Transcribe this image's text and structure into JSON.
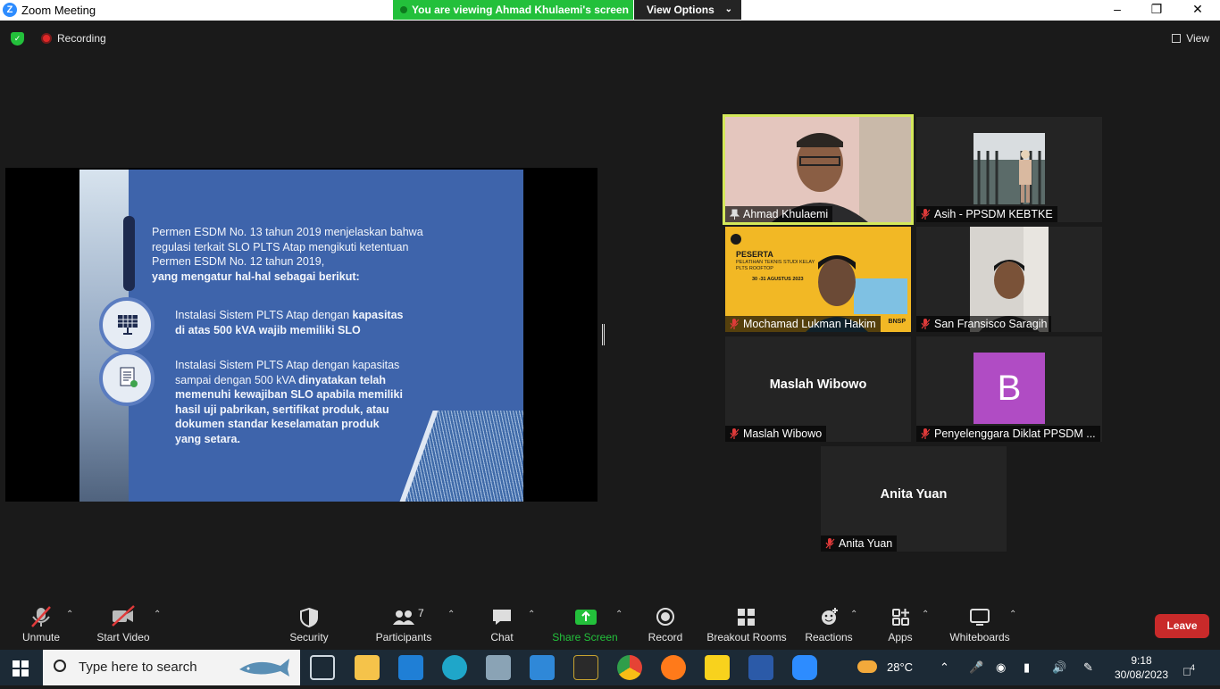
{
  "window": {
    "title": "Zoom Meeting",
    "viewing_banner": "You are viewing Ahmad Khulaemi's screen",
    "view_options": "View Options",
    "controls": {
      "minimize": "–",
      "restore": "❐",
      "close": "✕"
    }
  },
  "topbar": {
    "recording_label": "Recording",
    "view_label": "View"
  },
  "slide": {
    "intro_line1": "Permen ESDM No. 13 tahun 2019 menjelaskan bahwa",
    "intro_line2": "regulasi terkait SLO PLTS Atap mengikuti ketentuan",
    "intro_line3": "Permen ESDM No. 12 tahun 2019,",
    "intro_bold": "yang mengatur hal-hal sebagai berikut:",
    "point1_a": "Instalasi Sistem PLTS Atap dengan ",
    "point1_b": "kapasitas",
    "point1_c": "di atas 500 kVA wajib memiliki SLO",
    "point2_a": "Instalasi Sistem PLTS Atap dengan kapasitas",
    "point2_b": "sampai dengan 500 kVA ",
    "point2_c": "dinyatakan telah",
    "point2_d": "memenuhi kewajiban SLO apabila memiliki",
    "point2_e": "hasil uji pabrikan, sertifikat produk, atau",
    "point2_f": "dokumen standar keselamatan produk",
    "point2_g": "yang setara."
  },
  "participants": [
    {
      "name": "Ahmad Khulaemi",
      "video": true,
      "active": true
    },
    {
      "name": "Asih - PPSDM KEBTKE",
      "video": true,
      "muted": true
    },
    {
      "name": "Mochamad Lukman Hakim",
      "video": true,
      "muted": true,
      "background_heading": "PESERTA",
      "background_line1": "PELATIHAN TEKNIS STUDI KELAY",
      "background_line2": "PLTS ROOFTOP",
      "background_line3": "30 -31 AGUSTUS 2023",
      "background_badge": "BNSP"
    },
    {
      "name": "San Fransisco Saragih",
      "video": true,
      "muted": true
    },
    {
      "name": "Maslah Wibowo",
      "video": false,
      "muted": true,
      "display": "Maslah Wibowo"
    },
    {
      "name": "Penyelenggara Diklat PPSDM ...",
      "video": false,
      "muted": true,
      "avatar_letter": "B"
    },
    {
      "name": "Anita Yuan",
      "video": false,
      "muted": true,
      "display": "Anita Yuan"
    }
  ],
  "toolbar": {
    "unmute": "Unmute",
    "start_video": "Start Video",
    "security": "Security",
    "participants": "Participants",
    "participants_count": "7",
    "chat": "Chat",
    "share_screen": "Share Screen",
    "record": "Record",
    "breakout_rooms": "Breakout Rooms",
    "reactions": "Reactions",
    "apps": "Apps",
    "whiteboards": "Whiteboards",
    "leave": "Leave"
  },
  "taskbar": {
    "search_placeholder": "Type here to search",
    "temperature": "28°C",
    "time": "9:18",
    "date": "30/08/2023",
    "notification_count": "4"
  },
  "colors": {
    "accent_green": "#23c03b",
    "leave_red": "#c92a2a",
    "active_speaker": "#d4e85a",
    "zoom_blue": "#2d8cff"
  }
}
